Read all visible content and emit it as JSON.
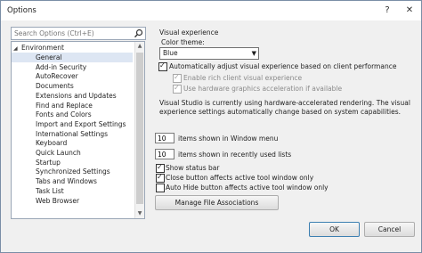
{
  "window": {
    "title": "Options",
    "help_glyph": "?",
    "close_glyph": "✕"
  },
  "search": {
    "placeholder": "Search Options (Ctrl+E)"
  },
  "tree": {
    "root_label": "Environment",
    "items": [
      "General",
      "Add-in Security",
      "AutoRecover",
      "Documents",
      "Extensions and Updates",
      "Find and Replace",
      "Fonts and Colors",
      "Import and Export Settings",
      "International Settings",
      "Keyboard",
      "Quick Launch",
      "Startup",
      "Synchronized Settings",
      "Tabs and Windows",
      "Task List",
      "Web Browser"
    ],
    "selected_index": 0
  },
  "panel": {
    "section_heading": "Visual experience",
    "color_theme_label": "Color theme:",
    "color_theme_value": "Blue",
    "auto_adjust_label": "Automatically adjust visual experience based on client performance",
    "rich_client_label": "Enable rich client visual experience",
    "hw_accel_label": "Use hardware graphics acceleration if available",
    "info_line1": "Visual Studio is currently using hardware-accelerated rendering. The visual",
    "info_line2": "experience settings automatically change based on system capabilities.",
    "window_menu_count": "10",
    "window_menu_label": "items shown in Window menu",
    "recent_lists_count": "10",
    "recent_lists_label": "items shown in recently used lists",
    "status_bar_label": "Show status bar",
    "close_btn_label": "Close button affects active tool window only",
    "auto_hide_label": "Auto Hide button affects active tool window only",
    "file_assoc_button": "Manage File Associations"
  },
  "footer": {
    "ok_label": "OK",
    "cancel_label": "Cancel"
  }
}
